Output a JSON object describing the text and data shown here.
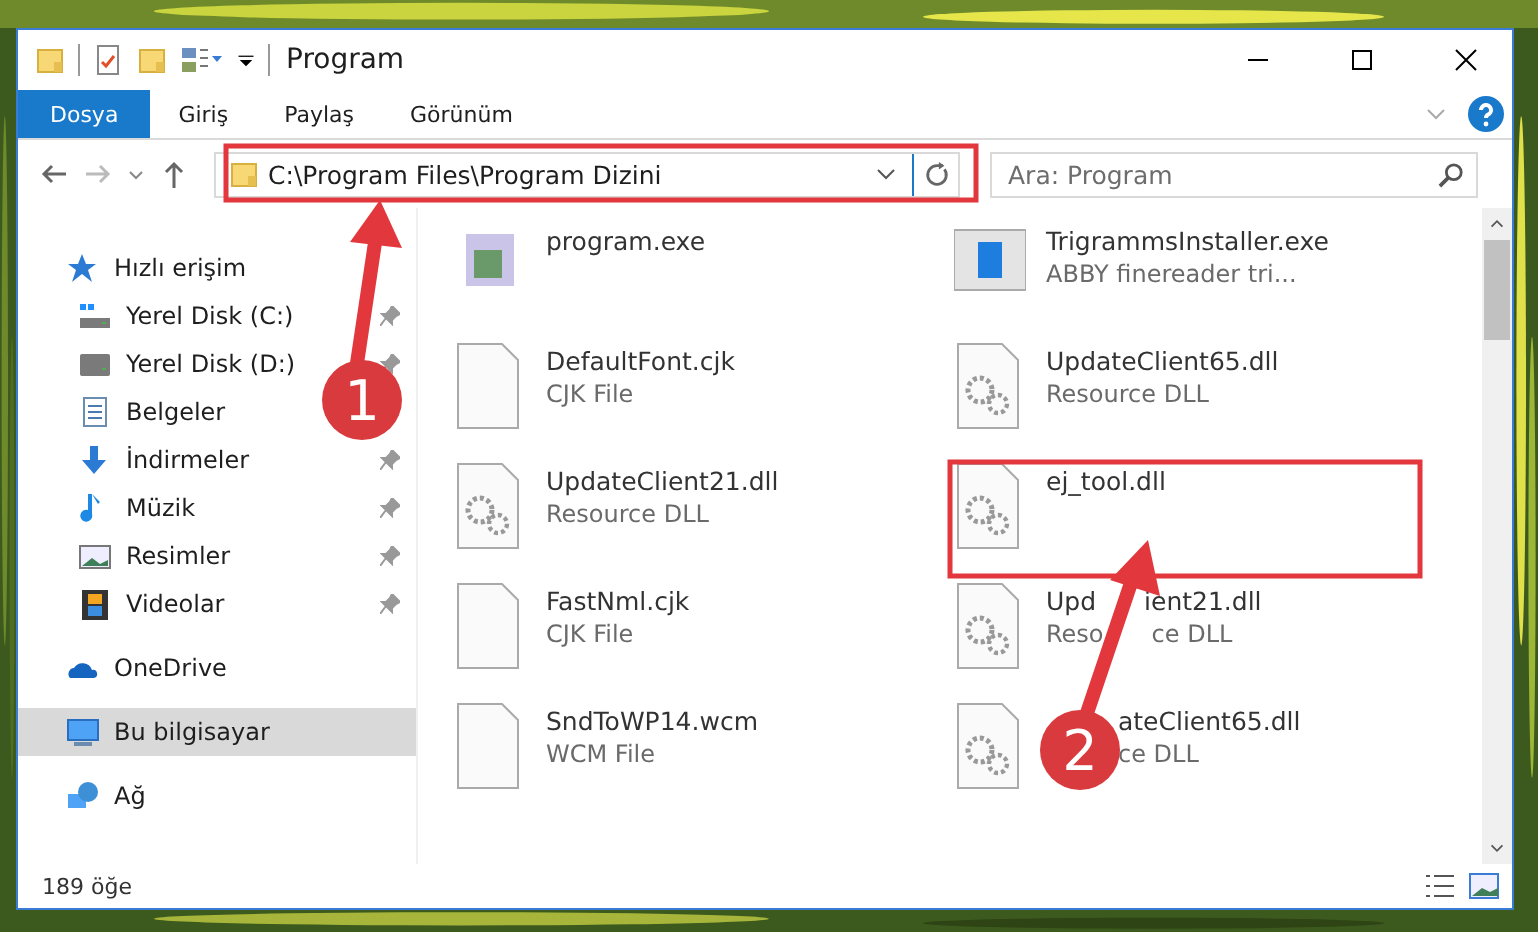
{
  "window": {
    "title": "Program"
  },
  "ribbon_tabs": [
    {
      "label": "Dosya",
      "kind": "file",
      "selected": false
    },
    {
      "label": "Giriş",
      "kind": "tab",
      "selected": false
    },
    {
      "label": "Paylaş",
      "kind": "tab",
      "selected": false
    },
    {
      "label": "Görünüm",
      "kind": "tab",
      "selected": false
    }
  ],
  "address_bar": {
    "value": "C:\\Program Files\\Program Dizini"
  },
  "search": {
    "placeholder": "Ara: Program"
  },
  "sidebar": {
    "items": [
      {
        "label": "Hızlı erişim",
        "kind": "star",
        "pinned": false,
        "selected": false,
        "children": [
          {
            "label": "Yerel Disk (C:)",
            "kind": "drive-c",
            "pinned": true,
            "selected": false
          },
          {
            "label": "Yerel Disk (D:)",
            "kind": "drive",
            "pinned": true,
            "selected": false
          },
          {
            "label": "Belgeler",
            "kind": "documents",
            "selected": false
          },
          {
            "label": "İndirmeler",
            "kind": "downloads",
            "pinned": true,
            "selected": false
          },
          {
            "label": "Müzik",
            "kind": "music",
            "pinned": true,
            "selected": false
          },
          {
            "label": "Resimler",
            "kind": "pictures",
            "pinned": true,
            "selected": false
          },
          {
            "label": "Videolar",
            "kind": "videos",
            "pinned": true,
            "selected": false
          }
        ]
      },
      {
        "label": "OneDrive",
        "kind": "cloud",
        "pinned": false,
        "selected": false
      },
      {
        "label": "Bu bilgisayar",
        "kind": "computer",
        "pinned": false,
        "selected": true
      },
      {
        "label": "Ağ",
        "kind": "network",
        "pinned": false,
        "selected": false
      }
    ]
  },
  "files": [
    {
      "name": "program.exe",
      "kind": "exe"
    },
    {
      "name": "TrigrammsInstaller.exe",
      "type": "ABBY finereader tri...",
      "kind": "installer"
    },
    {
      "name": "DefaultFont.cjk",
      "type": "CJK File",
      "kind": "file"
    },
    {
      "name": "UpdateClient65.dll",
      "type": "Resource DLL",
      "kind": "dll"
    },
    {
      "name": "UpdateClient21.dll",
      "type": "Resource DLL",
      "kind": "dll"
    },
    {
      "name": "ej_tool.dll",
      "kind": "dll"
    },
    {
      "name": "FastNml.cjk",
      "type": "CJK File",
      "kind": "file"
    },
    {
      "name_head": "Upd",
      "name": "ient21.dll",
      "type_head": "Reso",
      "type": "ce DLL",
      "kind": "dll",
      "covered": true
    },
    {
      "name": "SndToWP14.wcm",
      "type": "WCM File",
      "kind": "file"
    },
    {
      "name": "ateClient65.dll",
      "type": "ce DLL",
      "kind": "dll",
      "covered": true
    }
  ],
  "status_bar": {
    "count": "189 öğe"
  },
  "annotations": [
    {
      "label": "1"
    },
    {
      "label": "2"
    }
  ]
}
